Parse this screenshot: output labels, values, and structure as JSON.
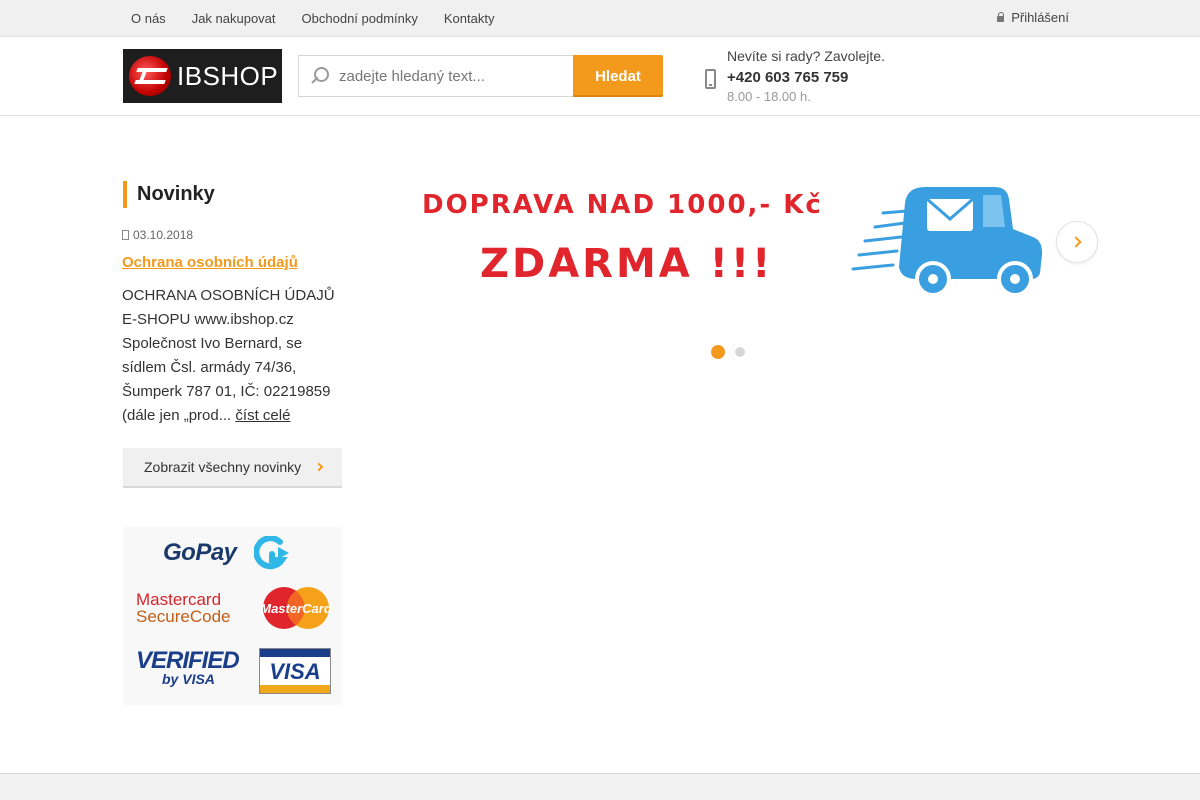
{
  "topnav": {
    "items": [
      {
        "label": "O nás"
      },
      {
        "label": "Jak nakupovat"
      },
      {
        "label": "Obchodní podmínky"
      },
      {
        "label": "Kontakty"
      }
    ],
    "login_label": "Přihlášení"
  },
  "header": {
    "logo_text": "IBSHOP",
    "search_placeholder": "zadejte hledaný text...",
    "search_button": "Hledat",
    "contact_question": "Nevíte si rady? Zavolejte.",
    "contact_phone": "+420 603 765 759",
    "contact_hours": "8.00 - 18.00 h."
  },
  "news": {
    "heading": "Novinky",
    "date": "03.10.2018",
    "title": "Ochrana osobních údajů",
    "excerpt": "OCHRANA OSOBNÍCH ÚDAJŮ E-SHOPU www.ibshop.cz Společnost Ivo Bernard, se sídlem Čsl. armády 74/36, Šumperk 787 01, IČ: 02219859 (dále jen „prod...",
    "read_more": "číst celé",
    "all_button": "Zobrazit všechny novinky"
  },
  "payments": {
    "gopay": "GoPay",
    "mastercard_line1": "Mastercard",
    "mastercard_line2": "SecureCode",
    "mastercard_logo": "MasterCard",
    "verified_line1": "VERIFIED",
    "verified_line2": "by VISA",
    "visa": "VISA"
  },
  "banner": {
    "line1": "DOPRAVA NAD 1000,- Kč",
    "line2": "ZDARMA !!!",
    "slides_total": 2,
    "active_slide": 1
  },
  "colors": {
    "accent": "#f39a1d",
    "banner_red": "#e0262c",
    "truck_blue": "#3a9fe0"
  }
}
